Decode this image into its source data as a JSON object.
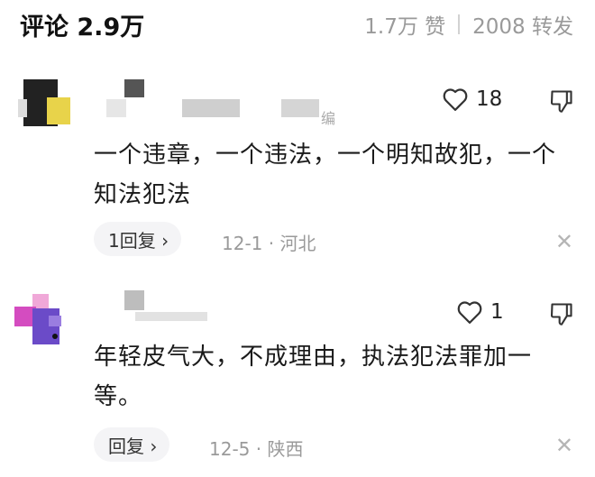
{
  "header": {
    "title": "评论 2.9万",
    "likes": "1.7万 赞",
    "forwards": "2008 转发"
  },
  "comments": [
    {
      "likes": "18",
      "username_fragment": "编",
      "text": "一个违章，一个违法，一个明知故犯，一个知法犯法",
      "reply_label": "1回复 ›",
      "time": "12-1",
      "location": "河北"
    },
    {
      "likes": "1",
      "text": "年轻皮气大，不成理由，执法犯法罪加一等。",
      "reply_label": "回复 ›",
      "time": "12-5",
      "location": "陕西"
    }
  ],
  "icons": {
    "like": "heart-outline-icon",
    "dislike": "thumbs-down-icon",
    "close": "close-icon"
  },
  "meta_separator": "·",
  "close_glyph": "✕"
}
